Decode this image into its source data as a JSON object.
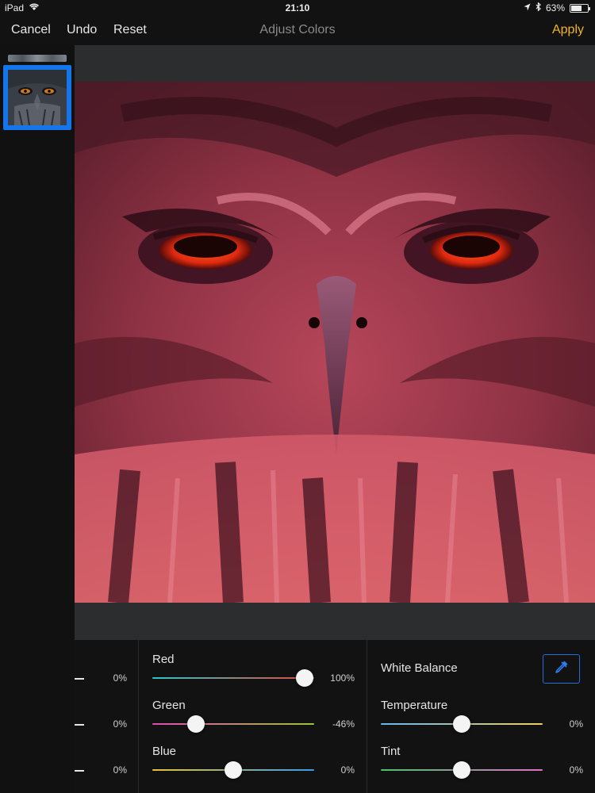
{
  "status": {
    "device": "iPad",
    "time": "21:10",
    "battery": "63%",
    "battery_level": 0.63
  },
  "nav": {
    "cancel": "Cancel",
    "undo": "Undo",
    "reset": "Reset",
    "title": "Adjust Colors",
    "apply": "Apply"
  },
  "colors": {
    "accent": "#1576ec",
    "apply": "#f2b51e"
  },
  "partial": [
    {
      "value": "0%"
    },
    {
      "value": "0%"
    },
    {
      "value": "0%"
    }
  ],
  "channels": [
    {
      "label": "Red",
      "value": "100%",
      "level": 1.0
    },
    {
      "label": "Green",
      "value": "-46%",
      "level": 0.27
    },
    {
      "label": "Blue",
      "value": "0%",
      "level": 0.5
    }
  ],
  "white_balance": {
    "label": "White Balance",
    "icon": "eyedropper-icon",
    "temperature": {
      "label": "Temperature",
      "value": "0%",
      "level": 0.5
    },
    "tint": {
      "label": "Tint",
      "value": "0%",
      "level": 0.5
    }
  }
}
